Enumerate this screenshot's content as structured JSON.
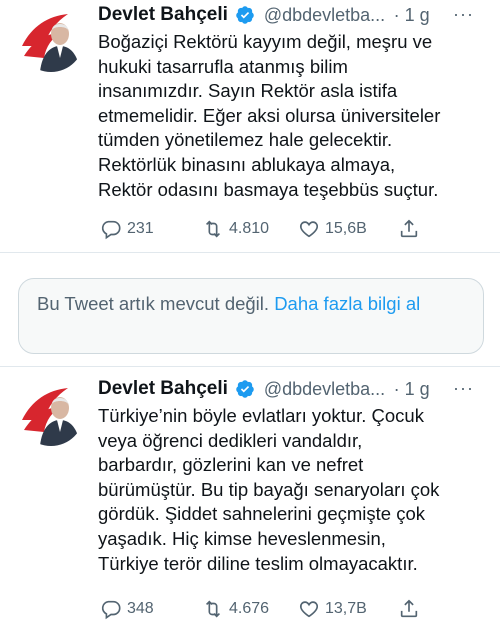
{
  "tweets": [
    {
      "author_name": "Devlet Bahçeli",
      "handle": "@dbdevletba...",
      "time": "· 1 g",
      "more": "···",
      "text": "Boğaziçi Rektörü kayyım değil, meşru ve\nhukuki tasarrufla atanmış bilim\ninsanımızdır. Sayın Rektör asla istifa\netmemelidir. Eğer aksi olursa üniversiteler\ntümden yönetilemez hale gelecektir.\nRektörlük binasını ablukaya almaya,\nRektör odasını basmaya teşebbüs suçtur.",
      "replies": "231",
      "retweets": "4.810",
      "likes": "15,6B"
    },
    {
      "author_name": "Devlet Bahçeli",
      "handle": "@dbdevletba...",
      "time": "· 1 g",
      "more": "···",
      "text": "Türkiye’nin böyle evlatları yoktur. Çocuk\nveya öğrenci dedikleri vandaldır,\nbarbardır, gözlerini kan ve nefret\nbürümüştür. Bu tip bayağı senaryoları çok\ngördük. Şiddet sahnelerini geçmişte çok\nyaşadık. Hiç kimse heveslenmesin,\nTürkiye terör diline teslim olmayacaktır.",
      "replies": "348",
      "retweets": "4.676",
      "likes": "13,7B"
    }
  ],
  "unavailable_notice": {
    "text": "Bu Tweet artık mevcut değil.",
    "link": "Daha fazla bilgi al"
  },
  "colors": {
    "accent": "#1d9bf0",
    "secondary_text": "#536471",
    "verified": "#1d9bf0"
  },
  "icons": [
    "reply-icon",
    "retweet-icon",
    "like-icon",
    "share-icon",
    "verified-badge-icon",
    "more-icon"
  ]
}
